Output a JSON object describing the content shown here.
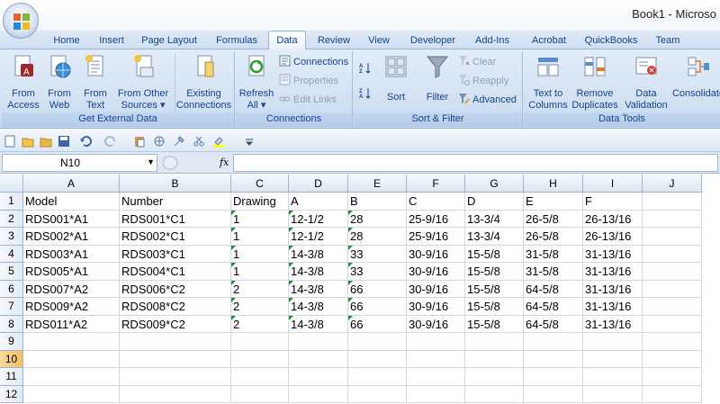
{
  "window": {
    "title": "Book1 - Microso"
  },
  "tabs": [
    "Home",
    "Insert",
    "Page Layout",
    "Formulas",
    "Data",
    "Review",
    "View",
    "Developer",
    "Add-Ins",
    "Acrobat",
    "QuickBooks",
    "Team"
  ],
  "active_tab": "Data",
  "ribbon": {
    "get_external": {
      "label": "Get External Data",
      "from_access": [
        "From",
        "Access"
      ],
      "from_web": [
        "From",
        "Web"
      ],
      "from_text": [
        "From",
        "Text"
      ],
      "from_other": [
        "From Other",
        "Sources ▾"
      ],
      "existing": [
        "Existing",
        "Connections"
      ]
    },
    "connections": {
      "label": "Connections",
      "refresh": [
        "Refresh",
        "All ▾"
      ],
      "connections": "Connections",
      "properties": "Properties",
      "edit_links": "Edit Links"
    },
    "sort_filter": {
      "label": "Sort & Filter",
      "sort": "Sort",
      "filter": "Filter",
      "clear": "Clear",
      "reapply": "Reapply",
      "advanced": "Advanced"
    },
    "data_tools": {
      "label": "Data Tools",
      "text_to_columns": [
        "Text to",
        "Columns"
      ],
      "remove_duplicates": [
        "Remove",
        "Duplicates"
      ],
      "data_validation": [
        "Data",
        "Validation ▾"
      ],
      "consolidate": "Consolidate"
    }
  },
  "formula_bar": {
    "name_box": "N10",
    "fx": "fx",
    "content": ""
  },
  "grid": {
    "columns": [
      "A",
      "B",
      "C",
      "D",
      "E",
      "F",
      "G",
      "H",
      "I",
      "J"
    ],
    "rows": [
      "1",
      "2",
      "3",
      "4",
      "5",
      "6",
      "7",
      "8",
      "9",
      "10",
      "11",
      "12"
    ],
    "selected_row": "10",
    "cells": [
      [
        "Model",
        "Number",
        "Drawing",
        "A",
        "B",
        "C",
        "D",
        "E",
        "F",
        ""
      ],
      [
        "RDS001*A1",
        "RDS001*C1",
        "1",
        "12-1/2",
        "28",
        "25-9/16",
        "13-3/4",
        "26-5/8",
        "26-13/16",
        ""
      ],
      [
        "RDS002*A1",
        "RDS002*C1",
        "1",
        "12-1/2",
        "28",
        "25-9/16",
        "13-3/4",
        "26-5/8",
        "26-13/16",
        ""
      ],
      [
        "RDS003*A1",
        "RDS003*C1",
        "1",
        "14-3/8",
        "33",
        "30-9/16",
        "15-5/8",
        "31-5/8",
        "31-13/16",
        ""
      ],
      [
        "RDS005*A1",
        "RDS004*C1",
        "1",
        "14-3/8",
        "33",
        "30-9/16",
        "15-5/8",
        "31-5/8",
        "31-13/16",
        ""
      ],
      [
        "RDS007*A2",
        "RDS006*C2",
        "2",
        "14-3/8",
        "66",
        "30-9/16",
        "15-5/8",
        "64-5/8",
        "31-13/16",
        ""
      ],
      [
        "RDS009*A2",
        "RDS008*C2",
        "2",
        "14-3/8",
        "66",
        "30-9/16",
        "15-5/8",
        "64-5/8",
        "31-13/16",
        ""
      ],
      [
        "RDS011*A2",
        "RDS009*C2",
        "2",
        "14-3/8",
        "66",
        "30-9/16",
        "15-5/8",
        "64-5/8",
        "31-13/16",
        ""
      ],
      [
        "",
        "",
        "",
        "",
        "",
        "",
        "",
        "",
        "",
        ""
      ],
      [
        "",
        "",
        "",
        "",
        "",
        "",
        "",
        "",
        "",
        ""
      ],
      [
        "",
        "",
        "",
        "",
        "",
        "",
        "",
        "",
        "",
        ""
      ],
      [
        "",
        "",
        "",
        "",
        "",
        "",
        "",
        "",
        "",
        ""
      ]
    ]
  },
  "colors": {
    "tri": "#1e8f2f",
    "selected_row": "#f1c15f"
  }
}
